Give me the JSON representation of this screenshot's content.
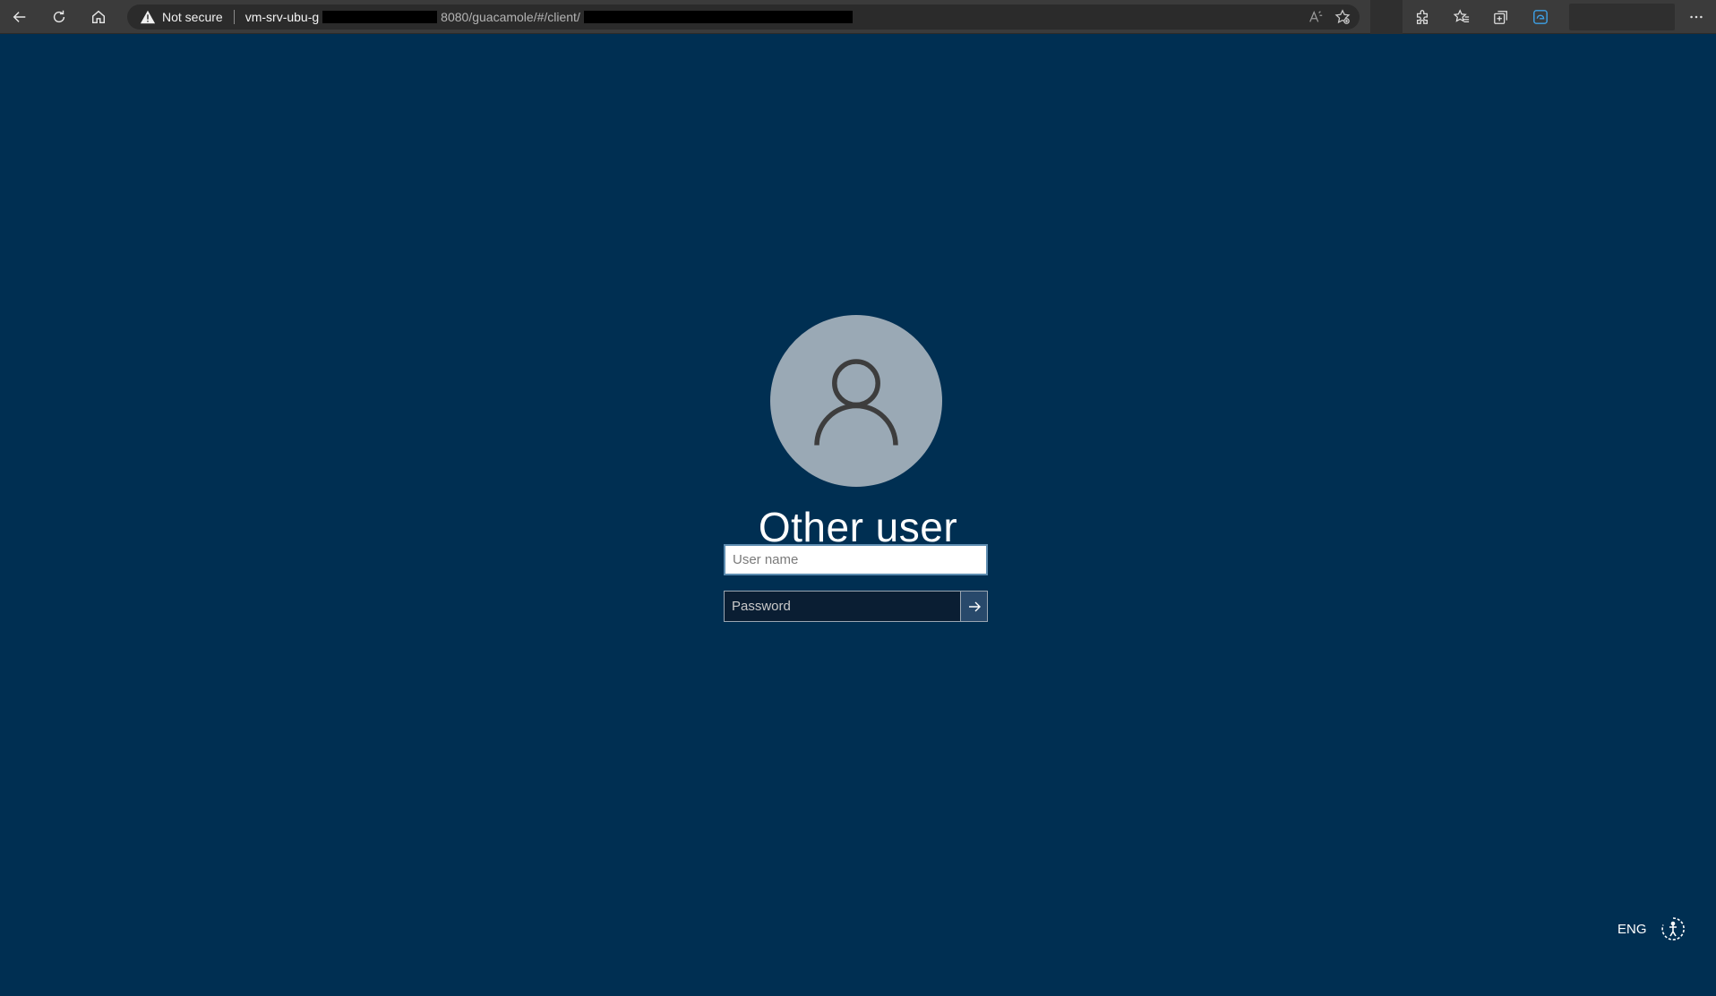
{
  "browser": {
    "security_label": "Not secure",
    "url_host": "vm-srv-ubu-g",
    "url_path": "8080/guacamole/#/client/",
    "icons": [
      "back-icon",
      "refresh-icon",
      "home-icon",
      "warning-icon",
      "read-aloud-icon",
      "add-favorite-icon",
      "extensions-icon",
      "favorites-icon",
      "collections-icon",
      "edge-icon",
      "more-icon"
    ]
  },
  "login": {
    "title": "Other user",
    "username_placeholder": "User name",
    "password_placeholder": "Password",
    "submit_icon": "arrow-right-icon",
    "avatar_icon": "user-icon"
  },
  "status": {
    "language": "ENG",
    "accessibility_icon": "ease-of-access-icon"
  },
  "colors": {
    "desktop_bg": "#002f52",
    "avatar_bg": "#9aa9b5",
    "submit_bg": "#28496b"
  }
}
